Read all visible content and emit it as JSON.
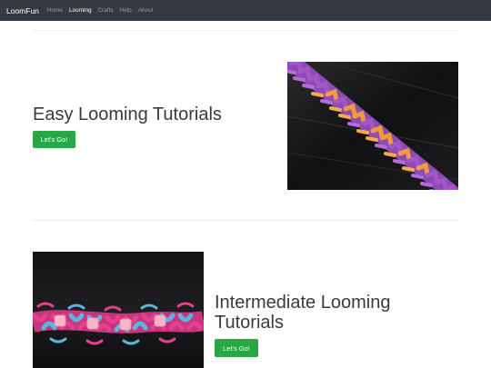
{
  "navbar": {
    "brand": "LoomFun",
    "items": [
      {
        "label": "Home",
        "active": false
      },
      {
        "label": "Looming",
        "active": true
      },
      {
        "label": "Crafts",
        "active": false
      },
      {
        "label": "Help",
        "active": false
      },
      {
        "label": "About",
        "active": false
      }
    ]
  },
  "sections": [
    {
      "title": "Easy Looming Tutorials",
      "button_label": "Let's Go!"
    },
    {
      "title_line1": "Intermediate Looming",
      "title_line2": "Tutorials",
      "button_label": "Let's Go!"
    }
  ],
  "colors": {
    "navbar_bg": "#343a40",
    "button_green": "#28a745",
    "bracelet1_purple": "#a256c8",
    "bracelet1_orange": "#f29a3e",
    "bracelet2_pink": "#e4408f",
    "bracelet2_blue": "#5cb6dc",
    "bead_pink": "#f5b7c8"
  }
}
